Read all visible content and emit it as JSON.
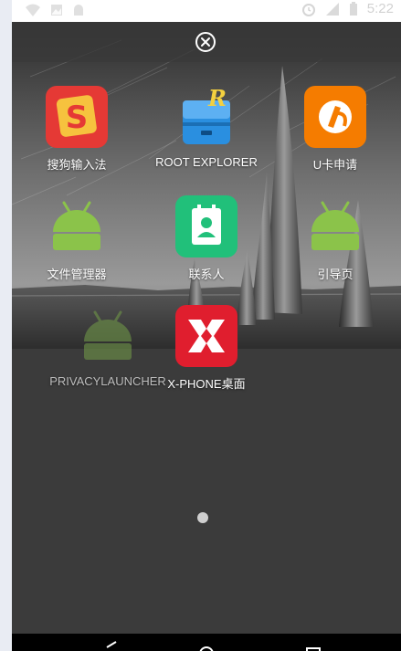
{
  "status_bar": {
    "time": "5:22",
    "icons_left": [
      "wifi-off-icon",
      "image-icon",
      "android-icon"
    ],
    "icons_right": [
      "alarm-icon",
      "signal-icon",
      "battery-icon"
    ]
  },
  "header": {
    "close_icon": "close-circle-icon"
  },
  "apps": [
    {
      "label": "搜狗输入法",
      "icon": "sogou-icon",
      "color": "#e53935"
    },
    {
      "label": "ROOT EXPLORER",
      "icon": "root-explorer-icon",
      "color": "#2a8fe0"
    },
    {
      "label": "U卡申请",
      "icon": "ucard-icon",
      "color": "#f57c00"
    },
    {
      "label": "文件管理器",
      "icon": "android-icon",
      "color": "#8bc34a"
    },
    {
      "label": "联系人",
      "icon": "contacts-icon",
      "color": "#21c07a"
    },
    {
      "label": "引导页",
      "icon": "android-icon",
      "color": "#8bc34a"
    },
    {
      "label": "PRIVACYLAUNCHER",
      "icon": "android-icon",
      "color": "#6b8f47"
    },
    {
      "label": "X-PHONE桌面",
      "icon": "xphone-icon",
      "color": "#e01e2e"
    }
  ],
  "pager": {
    "page_dot": "page-indicator"
  },
  "nav": {
    "buttons": [
      "back-icon",
      "home-icon",
      "recents-icon"
    ]
  }
}
